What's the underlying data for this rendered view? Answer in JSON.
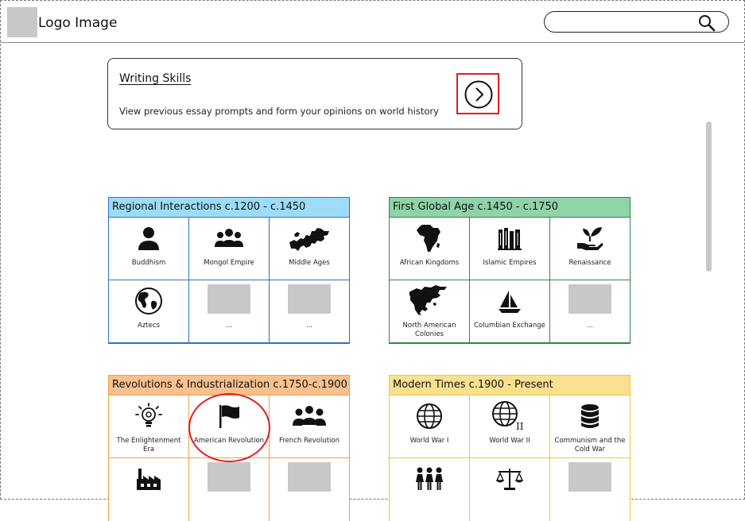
{
  "header": {
    "logo_text": "Logo Image",
    "search": {
      "placeholder": "",
      "value": ""
    }
  },
  "writing_skills": {
    "title": "Writing Skills",
    "description": "View previous essay prompts and form your opinions on world history"
  },
  "panels": [
    {
      "title": "Regional Interactions c.1200 - c.1450",
      "accent": "#2f6fc9",
      "header_color": "#9cdcf7",
      "items": [
        {
          "label": "Buddhism",
          "icon": "person-icon"
        },
        {
          "label": "Mongol Empire",
          "icon": "group-icon"
        },
        {
          "label": "Middle Ages",
          "icon": "europe-map-icon"
        },
        {
          "label": "Aztecs",
          "icon": "globe-americas-icon"
        },
        {
          "label": "...",
          "icon": "placeholder"
        },
        {
          "label": "...",
          "icon": "placeholder"
        }
      ]
    },
    {
      "title": "First Global Age c.1450 - c.1750",
      "accent": "#2b8a3e",
      "header_color": "#8fd3a7",
      "items": [
        {
          "label": "African Kingdoms",
          "icon": "africa-map-icon"
        },
        {
          "label": "Islamic Empires",
          "icon": "books-icon"
        },
        {
          "label": "Renaissance",
          "icon": "hand-plant-icon"
        },
        {
          "label": "North American Colonies",
          "icon": "north-america-map-icon"
        },
        {
          "label": "Columbian Exchange",
          "icon": "sailboat-icon"
        },
        {
          "label": "...",
          "icon": "placeholder"
        }
      ]
    },
    {
      "title": "Revolutions & Industrialization c.1750-c.1900",
      "accent": "#f0a040",
      "header_color": "#f7c08e",
      "items": [
        {
          "label": "The Enlightenment Era",
          "icon": "lightbulb-icon"
        },
        {
          "label": "American Revolution",
          "icon": "flag-icon"
        },
        {
          "label": "French Revolution",
          "icon": "crowd-icon"
        },
        {
          "label": "",
          "icon": "factory-icon"
        },
        {
          "label": "",
          "icon": "placeholder"
        },
        {
          "label": "",
          "icon": "placeholder"
        }
      ]
    },
    {
      "title": "Modern Times c.1900 - Present",
      "accent": "#f0c838",
      "header_color": "#f9e08e",
      "items": [
        {
          "label": "World War I",
          "icon": "globe-grid-icon"
        },
        {
          "label": "World War II",
          "icon": "globe-grid-ii-icon",
          "badge": "II"
        },
        {
          "label": "Communism and the Cold War",
          "icon": "database-icon"
        },
        {
          "label": "",
          "icon": "women-group-icon"
        },
        {
          "label": "",
          "icon": "scales-icon"
        },
        {
          "label": "",
          "icon": "placeholder"
        }
      ]
    }
  ]
}
